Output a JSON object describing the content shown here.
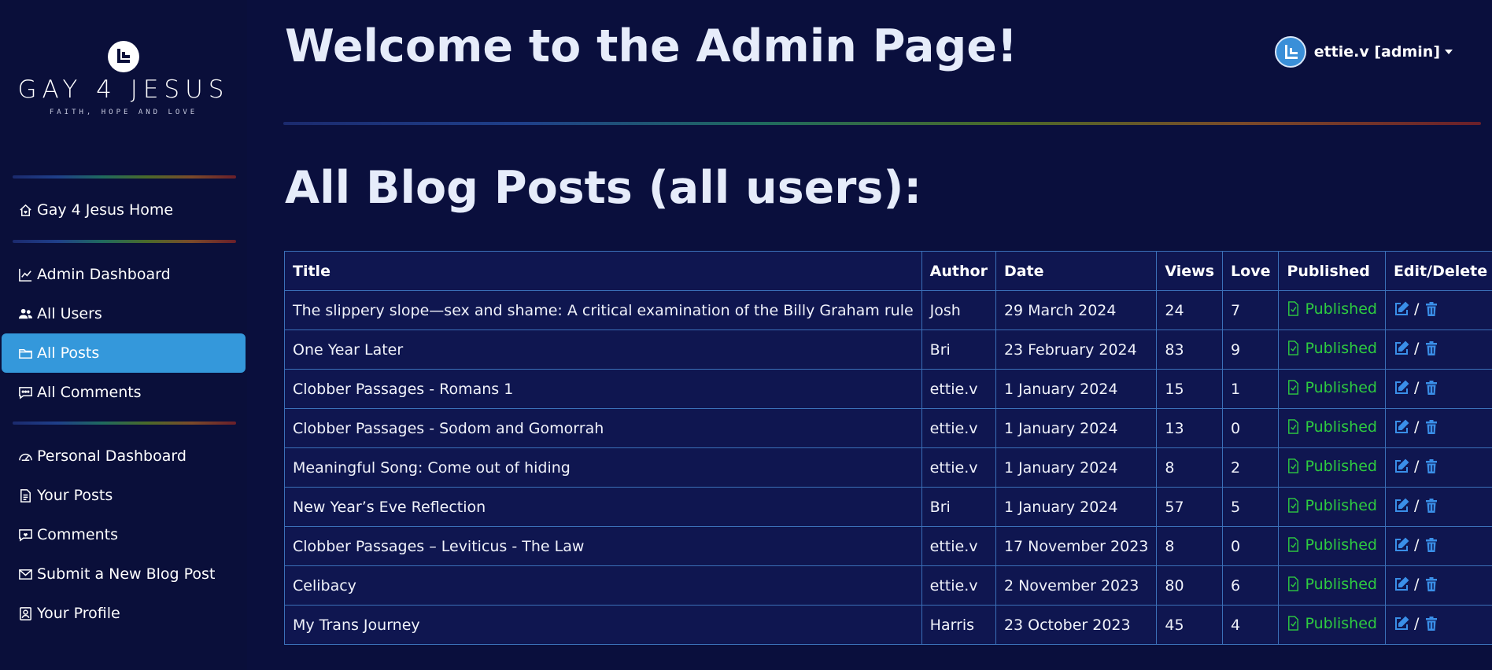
{
  "brand": {
    "name": "GAY 4 JESUS",
    "tagline": "FAITH, HOPE AND LOVE"
  },
  "sidebar": {
    "items": [
      {
        "label": "Gay 4 Jesus Home",
        "icon": "home-heart-icon"
      },
      {
        "label": "Admin Dashboard",
        "icon": "chart-line-icon"
      },
      {
        "label": "All Users",
        "icon": "users-icon"
      },
      {
        "label": "All Posts",
        "icon": "folder-icon",
        "active": true
      },
      {
        "label": "All Comments",
        "icon": "chat-dots-icon"
      },
      {
        "label": "Personal Dashboard",
        "icon": "speedometer-icon"
      },
      {
        "label": "Your Posts",
        "icon": "document-icon"
      },
      {
        "label": "Comments",
        "icon": "chat-heart-icon"
      },
      {
        "label": "Submit a New Blog Post",
        "icon": "envelope-icon"
      },
      {
        "label": "Your Profile",
        "icon": "person-badge-icon"
      }
    ]
  },
  "header": {
    "title": "Welcome to the Admin Page!",
    "user": "ettie.v [admin]"
  },
  "main": {
    "section_title": "All Blog Posts (all users):",
    "columns": [
      "Title",
      "Author",
      "Date",
      "Views",
      "Love",
      "Published",
      "Edit/Delete"
    ],
    "separator": "/",
    "rows": [
      {
        "title": "The slippery slope—sex and shame: A critical examination of the Billy Graham rule",
        "author": "Josh",
        "date": "29 March 2024",
        "views": "24",
        "love": "7",
        "status": "Published"
      },
      {
        "title": "One Year Later",
        "author": "Bri",
        "date": "23 February 2024",
        "views": "83",
        "love": "9",
        "status": "Published"
      },
      {
        "title": "Clobber Passages - Romans 1",
        "author": "ettie.v",
        "date": "1 January 2024",
        "views": "15",
        "love": "1",
        "status": "Published"
      },
      {
        "title": "Clobber Passages - Sodom and Gomorrah",
        "author": "ettie.v",
        "date": "1 January 2024",
        "views": "13",
        "love": "0",
        "status": "Published"
      },
      {
        "title": "Meaningful Song: Come out of hiding",
        "author": "ettie.v",
        "date": "1 January 2024",
        "views": "8",
        "love": "2",
        "status": "Published"
      },
      {
        "title": "New Year’s Eve Reflection",
        "author": "Bri",
        "date": "1 January 2024",
        "views": "57",
        "love": "5",
        "status": "Published"
      },
      {
        "title": "Clobber Passages – Leviticus - The Law",
        "author": "ettie.v",
        "date": "17 November 2023",
        "views": "8",
        "love": "0",
        "status": "Published"
      },
      {
        "title": "Celibacy",
        "author": "ettie.v",
        "date": "2 November 2023",
        "views": "80",
        "love": "6",
        "status": "Published"
      },
      {
        "title": "My Trans Journey",
        "author": "Harris",
        "date": "23 October 2023",
        "views": "45",
        "love": "4",
        "status": "Published"
      }
    ]
  },
  "colors": {
    "background": "#0a0f3d",
    "active": "#3498db",
    "published": "#2ecc40",
    "action": "#3a8fe8",
    "border": "#3b70b8"
  }
}
